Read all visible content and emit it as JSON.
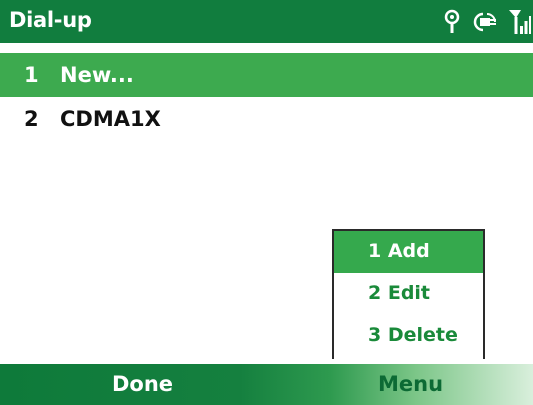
{
  "titlebar": {
    "title": "Dial-up",
    "icons": [
      "signal-antenna-icon",
      "connection-icon",
      "signal-strength-icon"
    ]
  },
  "list": {
    "items": [
      {
        "number": "1",
        "label": "New...",
        "selected": true
      },
      {
        "number": "2",
        "label": "CDMA1X",
        "selected": false
      }
    ]
  },
  "menu": {
    "items": [
      {
        "label": "1 Add",
        "selected": true
      },
      {
        "label": "2 Edit",
        "selected": false
      },
      {
        "label": "3 Delete",
        "selected": false
      }
    ]
  },
  "softkeys": {
    "left": "Done",
    "right": "Menu"
  },
  "colors": {
    "titlebar_bg": "#117d3e",
    "selection_bg": "#3daa4f",
    "menu_text": "#1a8a3a"
  }
}
